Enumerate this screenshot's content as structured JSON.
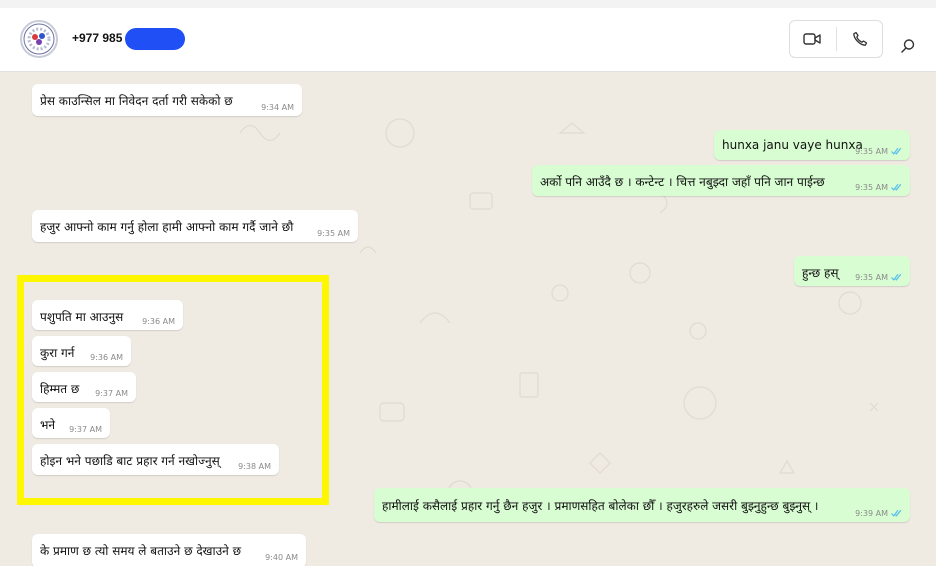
{
  "header": {
    "contact_name": "+977 985",
    "icons": {
      "video": "video-call-icon",
      "voice": "voice-call-icon",
      "search": "search-icon"
    }
  },
  "colors": {
    "incoming_bubble": "#ffffff",
    "outgoing_bubble": "#d9fdd3",
    "read_ticks": "#53bdeb",
    "highlight_box": "#fff700",
    "redaction": "#1f4ff5",
    "chat_background": "#efeae2"
  },
  "messages": [
    {
      "direction": "in",
      "text": "प्रेस काउन्सिल मा निवेदन दर्ता गरी सकेको छ",
      "time": "9:34 AM"
    },
    {
      "direction": "out",
      "text": "hunxa janu vaye hunxa",
      "time": "9:35 AM",
      "read": true
    },
    {
      "direction": "out",
      "text": "अर्को पनि आउँदै छ । कन्टेन्ट । चित्त नबुझ्दा जहाँ पनि  जान पाईन्छ",
      "time": "9:35 AM",
      "read": true
    },
    {
      "direction": "in",
      "text": "हजुर आफ्नो काम गर्नु होला हामी आफ्नो काम गर्दै जाने छौ",
      "time": "9:35 AM"
    },
    {
      "direction": "out",
      "text": "हुन्छ हस्",
      "time": "9:35 AM",
      "read": true
    },
    {
      "direction": "in",
      "text": "पशुपति मा आउनुस",
      "time": "9:36 AM"
    },
    {
      "direction": "in",
      "text": "कुरा गर्न",
      "time": "9:36 AM"
    },
    {
      "direction": "in",
      "text": "हिम्मत छ",
      "time": "9:37 AM"
    },
    {
      "direction": "in",
      "text": "भने",
      "time": "9:37 AM"
    },
    {
      "direction": "in",
      "text": "होइन भने पछाडि बाट प्रहार गर्न नखोज्नुस्",
      "time": "9:38 AM"
    },
    {
      "direction": "out",
      "text": "हामीलाई कसैलाई प्रहार गर्नु छैन हजुर । प्रमाणसहित बोलेका छौँ । हजुरहरुले जसरी बुझ्नुहुन्छ बुझ्नुस् ।",
      "time": "9:39 AM",
      "read": true
    },
    {
      "direction": "in",
      "text": "के प्रमाण छ त्यो समय ले बताउने छ देखाउने छ",
      "time": "9:40 AM"
    }
  ]
}
